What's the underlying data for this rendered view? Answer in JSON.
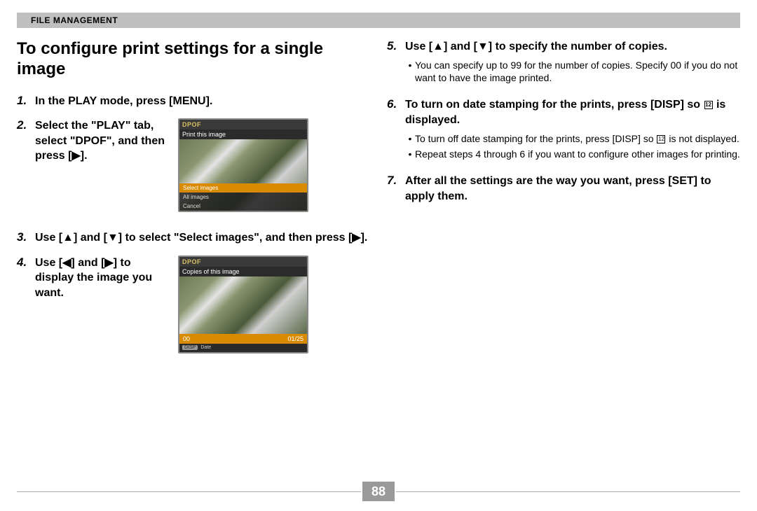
{
  "header": "FILE MANAGEMENT",
  "title": "To configure print settings for a single image",
  "left_steps": {
    "s1": "In the PLAY mode, press [MENU].",
    "s2": "Select the \"PLAY\" tab, select \"DPOF\", and then press [▶].",
    "s3": "Use [▲] and [▼] to select \"Select images\", and then press [▶].",
    "s4": "Use [◀] and [▶] to display the image you want."
  },
  "right_steps": {
    "s5": "Use [▲] and [▼] to specify the number of copies.",
    "s5_b1": "You can specify up to 99 for the number of copies. Specify 00 if you do not want to have the image printed.",
    "s6_a": "To turn on date stamping for the prints, press [DISP] so ",
    "s6_b": " is displayed.",
    "s6_b1_a": "To turn off date stamping for the prints, press [DISP] so ",
    "s6_b1_b": " is not displayed.",
    "s6_b2": "Repeat steps 4 through 6 if you want to configure other images for printing.",
    "s7": "After all the settings are the way you want, press [SET] to apply them."
  },
  "screenshot1": {
    "title": "DPOF",
    "subtitle": "Print this image",
    "menu1": "Select images",
    "menu2": "All images",
    "menu3": "Cancel"
  },
  "screenshot2": {
    "title": "DPOF",
    "subtitle": "Copies of this image",
    "copies": "00",
    "frame": "01/25",
    "bar_tag": "DISP",
    "bar_txt": "Date"
  },
  "icon_on": "12",
  "page_number": "88"
}
